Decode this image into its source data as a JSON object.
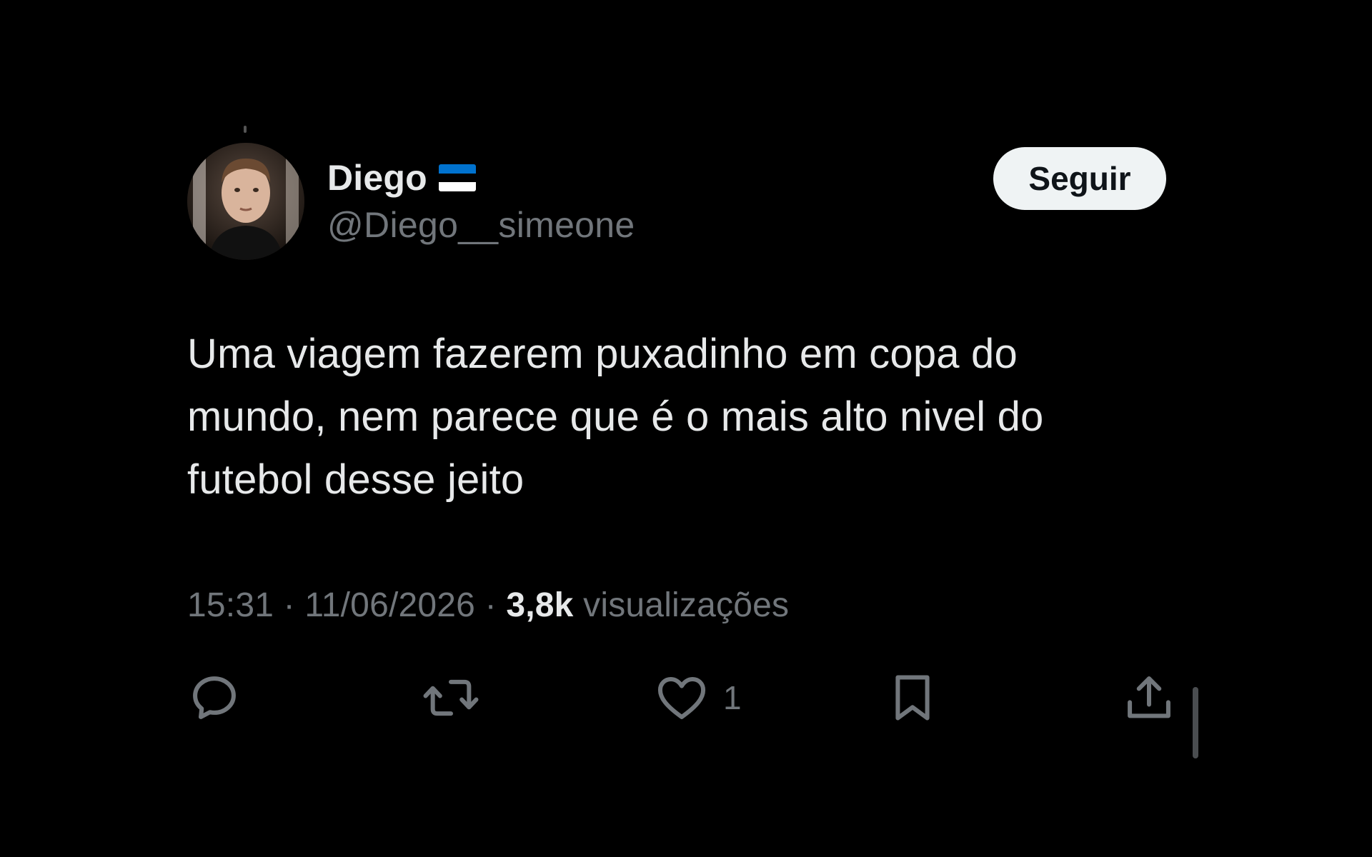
{
  "author": {
    "display_name": "Diego",
    "handle": "@Diego__simeone",
    "flag_icon": "estonia-flag-icon",
    "avatar_icon": "user-avatar-photo"
  },
  "follow_button": {
    "label": "Seguir"
  },
  "tweet": {
    "text": "Uma viagem fazerem puxadinho em copa do mundo, nem parece que é o mais alto nivel do futebol desse jeito"
  },
  "meta": {
    "time": "15:31",
    "separator": "·",
    "date": "11/06/2026",
    "views_count": "3,8k",
    "views_label": "visualizações"
  },
  "actions": {
    "reply_icon": "reply-bubble-icon",
    "retweet_icon": "retweet-icon",
    "like_icon": "heart-icon",
    "like_count": "1",
    "bookmark_icon": "bookmark-icon",
    "share_icon": "share-upload-icon"
  },
  "colors": {
    "background": "#000000",
    "primary_text": "#e7e9ea",
    "secondary_text": "#71767b",
    "button_bg": "#eff3f4",
    "button_text": "#0f1419",
    "flag_blue": "#0072ce",
    "flag_black": "#000000",
    "flag_white": "#ffffff"
  }
}
